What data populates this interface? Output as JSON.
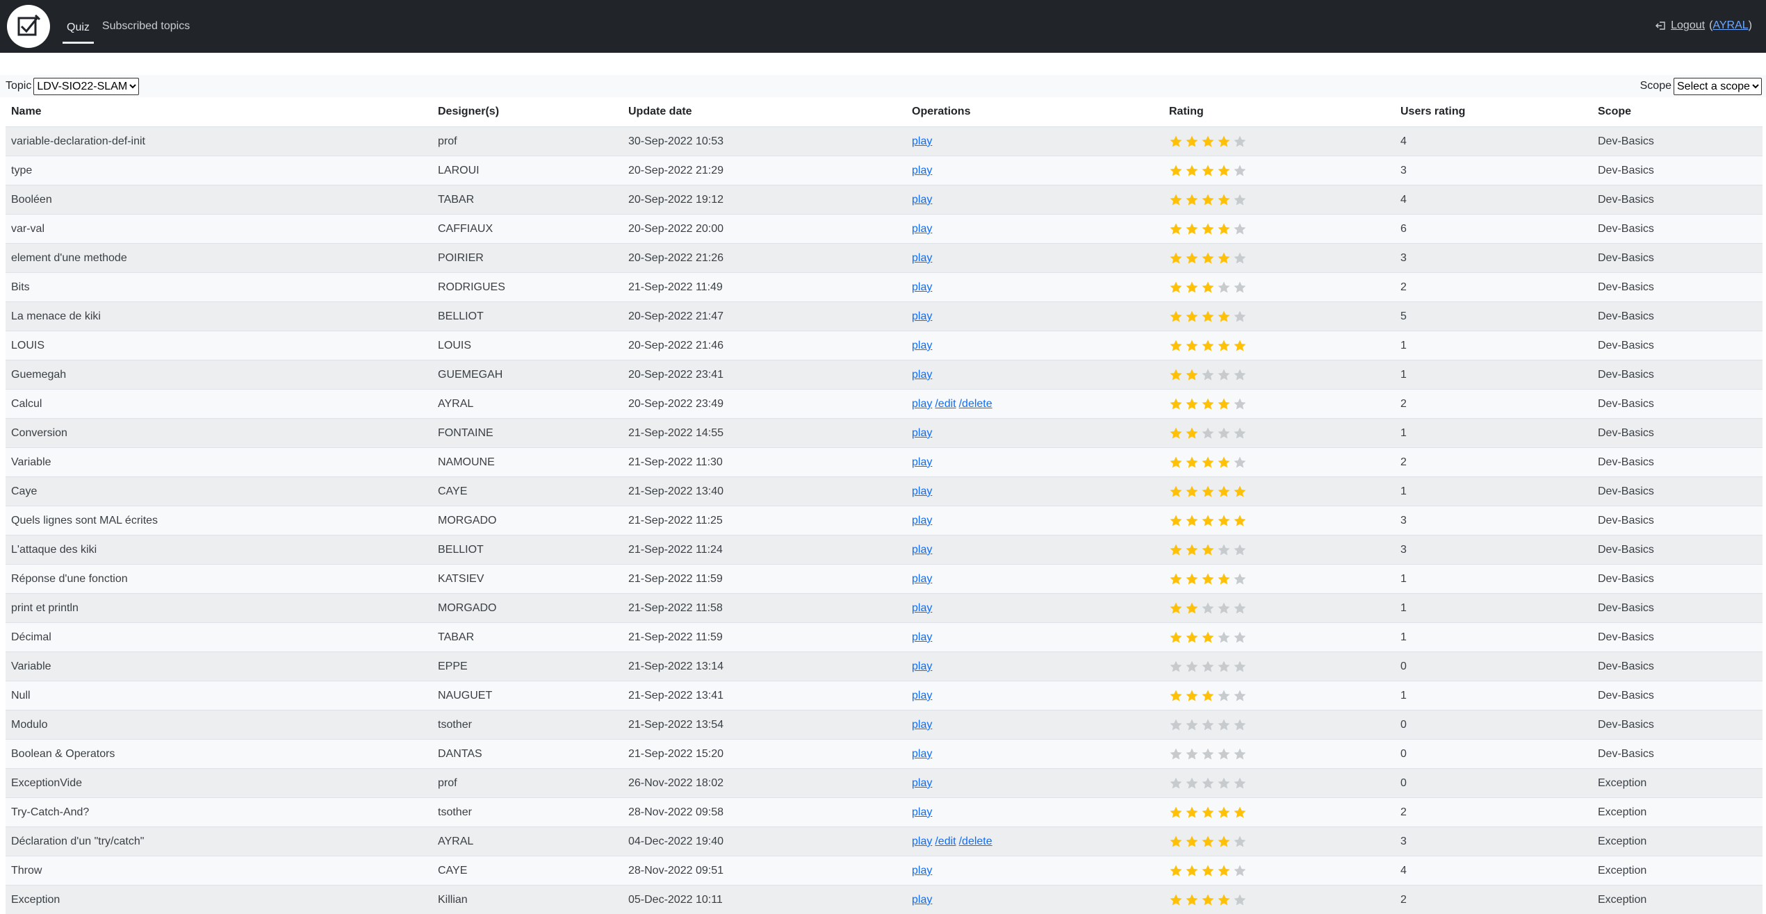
{
  "nav": {
    "quiz": "Quiz",
    "subscribed": "Subscribed topics",
    "logout": "Logout",
    "user": "AYRAL"
  },
  "filters": {
    "topic_label": "Topic",
    "topic_value": "LDV-SIO22-SLAM",
    "scope_label": "Scope",
    "scope_value": "Select a scope"
  },
  "headers": [
    "Name",
    "Designer(s)",
    "Update date",
    "Operations",
    "Rating",
    "Users rating",
    "Scope"
  ],
  "ops_labels": {
    "play": "play",
    "edit": "/edit",
    "delete": "/delete"
  },
  "colors": {
    "star_on": "#ffc107",
    "star_off": "#c8cbce",
    "link": "#0d6efd"
  },
  "rows": [
    {
      "name": "variable-declaration-def-init",
      "designer": "prof",
      "date": "30-Sep-2022 10:53",
      "ops": [
        "play"
      ],
      "rating": 4,
      "users": "4",
      "scope": "Dev-Basics"
    },
    {
      "name": "type",
      "designer": "LAROUI",
      "date": "20-Sep-2022 21:29",
      "ops": [
        "play"
      ],
      "rating": 4,
      "users": "3",
      "scope": "Dev-Basics"
    },
    {
      "name": "Booléen",
      "designer": "TABAR",
      "date": "20-Sep-2022 19:12",
      "ops": [
        "play"
      ],
      "rating": 4,
      "users": "4",
      "scope": "Dev-Basics"
    },
    {
      "name": "var-val",
      "designer": "CAFFIAUX",
      "date": "20-Sep-2022 20:00",
      "ops": [
        "play"
      ],
      "rating": 4,
      "users": "6",
      "scope": "Dev-Basics"
    },
    {
      "name": "element d'une methode",
      "designer": "POIRIER",
      "date": "20-Sep-2022 21:26",
      "ops": [
        "play"
      ],
      "rating": 4,
      "users": "3",
      "scope": "Dev-Basics"
    },
    {
      "name": "Bits",
      "designer": "RODRIGUES",
      "date": "21-Sep-2022 11:49",
      "ops": [
        "play"
      ],
      "rating": 3,
      "users": "2",
      "scope": "Dev-Basics"
    },
    {
      "name": "La menace de kiki",
      "designer": "BELLIOT",
      "date": "20-Sep-2022 21:47",
      "ops": [
        "play"
      ],
      "rating": 4,
      "users": "5",
      "scope": "Dev-Basics"
    },
    {
      "name": "LOUIS",
      "designer": "LOUIS",
      "date": "20-Sep-2022 21:46",
      "ops": [
        "play"
      ],
      "rating": 5,
      "users": "1",
      "scope": "Dev-Basics"
    },
    {
      "name": "Guemegah",
      "designer": "GUEMEGAH",
      "date": "20-Sep-2022 23:41",
      "ops": [
        "play"
      ],
      "rating": 2,
      "users": "1",
      "scope": "Dev-Basics"
    },
    {
      "name": "Calcul",
      "designer": "AYRAL",
      "date": "20-Sep-2022 23:49",
      "ops": [
        "play",
        "edit",
        "delete"
      ],
      "rating": 4,
      "users": "2",
      "scope": "Dev-Basics"
    },
    {
      "name": "Conversion",
      "designer": "FONTAINE",
      "date": "21-Sep-2022 14:55",
      "ops": [
        "play"
      ],
      "rating": 2,
      "users": "1",
      "scope": "Dev-Basics"
    },
    {
      "name": "Variable",
      "designer": "NAMOUNE",
      "date": "21-Sep-2022 11:30",
      "ops": [
        "play"
      ],
      "rating": 4,
      "users": "2",
      "scope": "Dev-Basics"
    },
    {
      "name": "Caye",
      "designer": "CAYE",
      "date": "21-Sep-2022 13:40",
      "ops": [
        "play"
      ],
      "rating": 5,
      "users": "1",
      "scope": "Dev-Basics"
    },
    {
      "name": "Quels lignes sont MAL écrites",
      "designer": "MORGADO",
      "date": "21-Sep-2022 11:25",
      "ops": [
        "play"
      ],
      "rating": 5,
      "users": "3",
      "scope": "Dev-Basics"
    },
    {
      "name": "L'attaque des kiki",
      "designer": "BELLIOT",
      "date": "21-Sep-2022 11:24",
      "ops": [
        "play"
      ],
      "rating": 3,
      "users": "3",
      "scope": "Dev-Basics"
    },
    {
      "name": "Réponse d'une fonction",
      "designer": "KATSIEV",
      "date": "21-Sep-2022 11:59",
      "ops": [
        "play"
      ],
      "rating": 4,
      "users": "1",
      "scope": "Dev-Basics"
    },
    {
      "name": "print et println",
      "designer": "MORGADO",
      "date": "21-Sep-2022 11:58",
      "ops": [
        "play"
      ],
      "rating": 2,
      "users": "1",
      "scope": "Dev-Basics"
    },
    {
      "name": "Décimal",
      "designer": "TABAR",
      "date": "21-Sep-2022 11:59",
      "ops": [
        "play"
      ],
      "rating": 3,
      "users": "1",
      "scope": "Dev-Basics"
    },
    {
      "name": "Variable",
      "designer": "EPPE",
      "date": "21-Sep-2022 13:14",
      "ops": [
        "play"
      ],
      "rating": 0,
      "users": "0",
      "scope": "Dev-Basics"
    },
    {
      "name": "Null",
      "designer": "NAUGUET",
      "date": "21-Sep-2022 13:41",
      "ops": [
        "play"
      ],
      "rating": 3,
      "users": "1",
      "scope": "Dev-Basics"
    },
    {
      "name": "Modulo",
      "designer": "tsother",
      "date": "21-Sep-2022 13:54",
      "ops": [
        "play"
      ],
      "rating": 0,
      "users": "0",
      "scope": "Dev-Basics"
    },
    {
      "name": "Boolean & Operators",
      "designer": "DANTAS",
      "date": "21-Sep-2022 15:20",
      "ops": [
        "play"
      ],
      "rating": 0,
      "users": "0",
      "scope": "Dev-Basics"
    },
    {
      "name": "ExceptionVide",
      "designer": "prof",
      "date": "26-Nov-2022 18:02",
      "ops": [
        "play"
      ],
      "rating": 0,
      "users": "0",
      "scope": "Exception"
    },
    {
      "name": "Try-Catch-And?",
      "designer": "tsother",
      "date": "28-Nov-2022 09:58",
      "ops": [
        "play"
      ],
      "rating": 5,
      "users": "2",
      "scope": "Exception"
    },
    {
      "name": "Déclaration d'un \"try/catch\"",
      "designer": "AYRAL",
      "date": "04-Dec-2022 19:40",
      "ops": [
        "play",
        "edit",
        "delete"
      ],
      "rating": 4,
      "users": "3",
      "scope": "Exception"
    },
    {
      "name": "Throw",
      "designer": "CAYE",
      "date": "28-Nov-2022 09:51",
      "ops": [
        "play"
      ],
      "rating": 4,
      "users": "4",
      "scope": "Exception"
    },
    {
      "name": "Exception",
      "designer": "Killian",
      "date": "05-Dec-2022 10:11",
      "ops": [
        "play"
      ],
      "rating": 4,
      "users": "2",
      "scope": "Exception"
    }
  ]
}
